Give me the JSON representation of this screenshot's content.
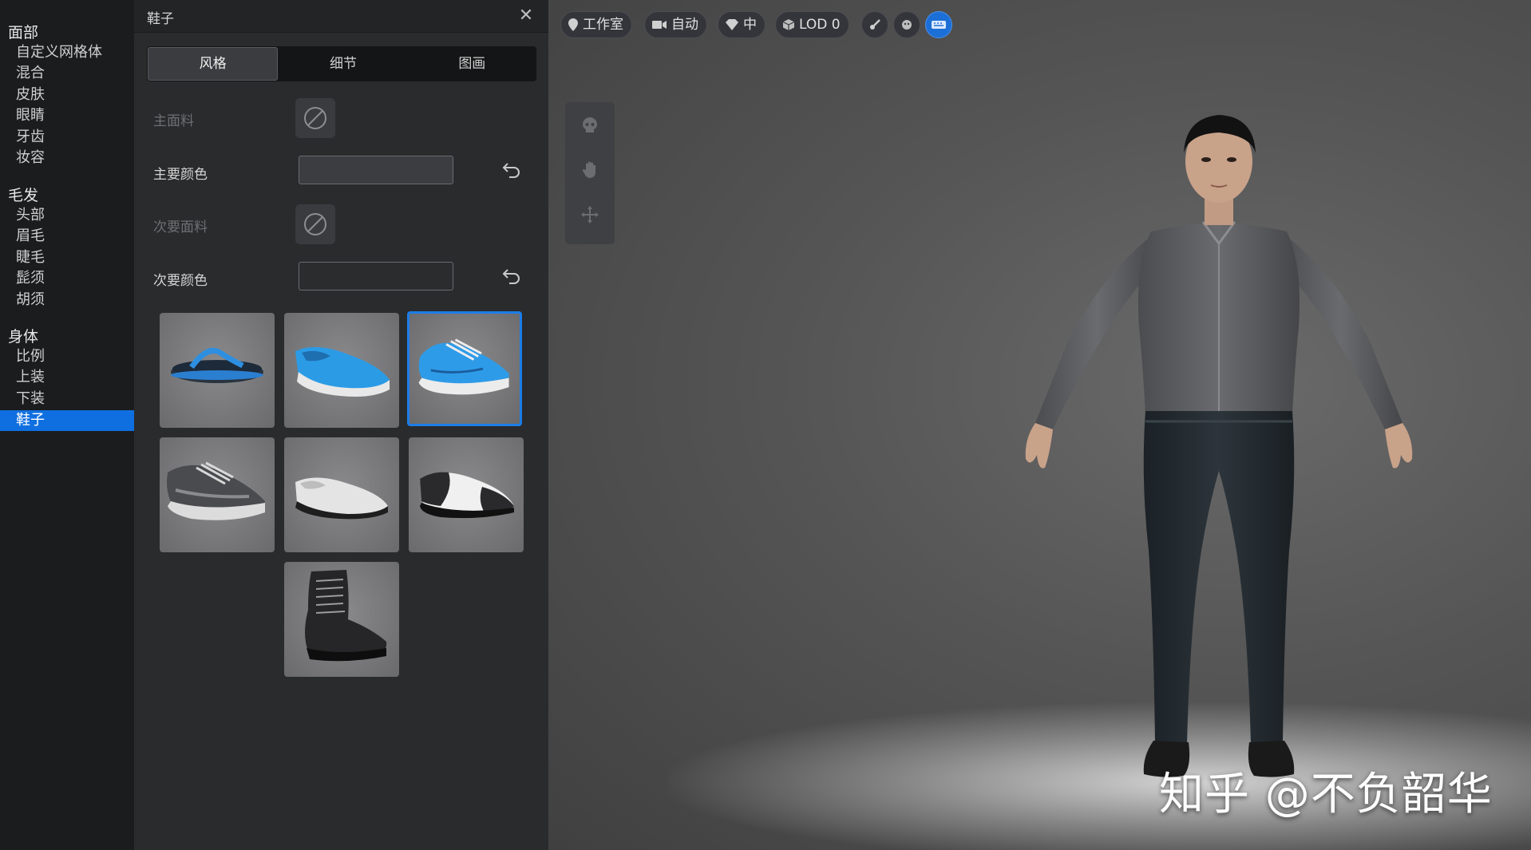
{
  "sidebar": {
    "groups": [
      {
        "title": "面部",
        "items": [
          "自定义网格体",
          "混合",
          "皮肤",
          "眼睛",
          "牙齿",
          "妆容"
        ]
      },
      {
        "title": "毛发",
        "items": [
          "头部",
          "眉毛",
          "睫毛",
          "髭须",
          "胡须"
        ]
      },
      {
        "title": "身体",
        "items": [
          "比例",
          "上装",
          "下装",
          "鞋子"
        ]
      }
    ],
    "selected_item": "鞋子"
  },
  "panel": {
    "title": "鞋子",
    "close_icon": "close-icon",
    "tabs": [
      "风格",
      "细节",
      "图画"
    ],
    "active_tab": "风格",
    "properties": {
      "primary_material": "主面料",
      "primary_color": "主要颜色",
      "secondary_material": "次要面料",
      "secondary_color": "次要颜色"
    },
    "colors": {
      "primary_swatch": "#3c3d40",
      "secondary_swatch": "#2b2c2e",
      "accent": "#1c7de8"
    },
    "shoes": [
      {
        "name": "flip-flop",
        "selected": false
      },
      {
        "name": "blue-slip-on",
        "selected": false
      },
      {
        "name": "blue-sneaker",
        "selected": true
      },
      {
        "name": "grey-running-shoe",
        "selected": false
      },
      {
        "name": "white-loafer",
        "selected": false
      },
      {
        "name": "black-white-oxford",
        "selected": false
      },
      {
        "name": "black-combat-boot",
        "selected": false
      }
    ]
  },
  "viewport": {
    "toolbar": {
      "environment": "工作室",
      "camera": "自动",
      "quality": "中",
      "lod": "LOD 0"
    },
    "watermark": "知乎 @不负韶华"
  }
}
